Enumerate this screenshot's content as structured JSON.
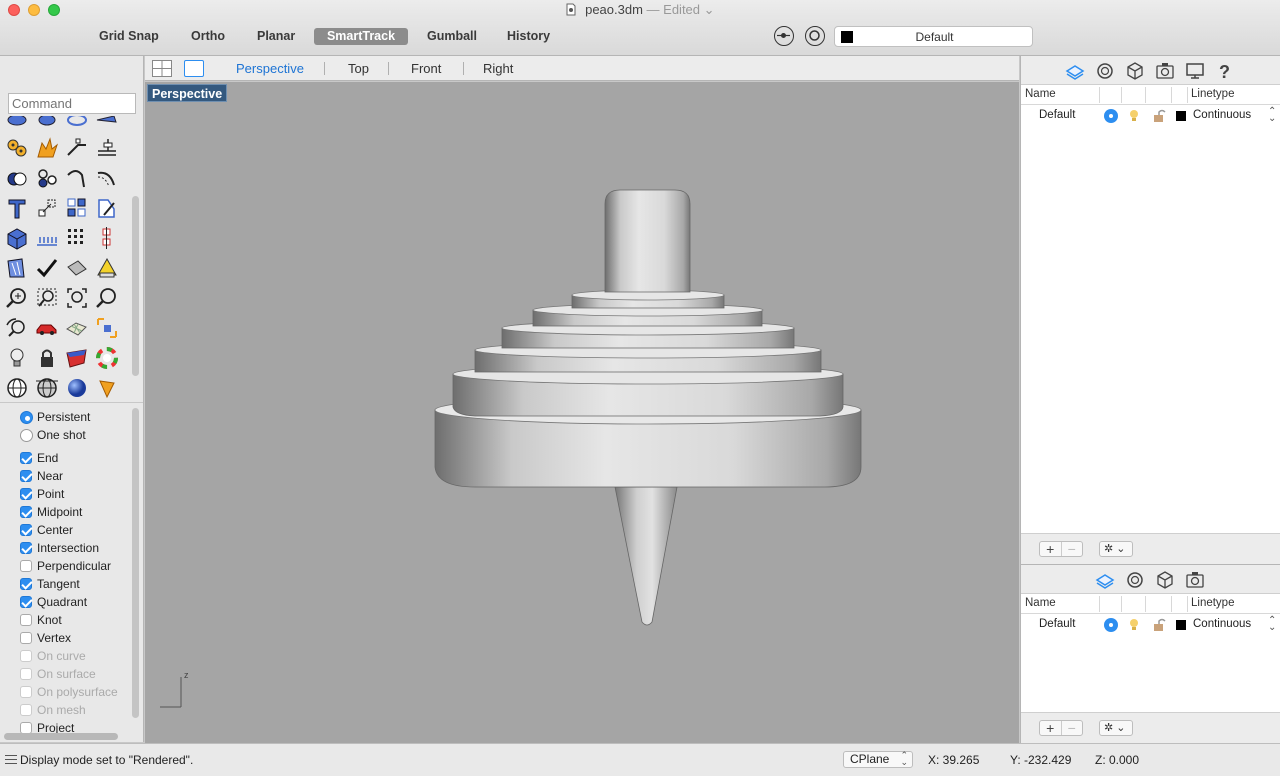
{
  "window": {
    "title": "peao.3dm",
    "edited": "— Edited ⌄"
  },
  "toolbar": {
    "items": [
      {
        "label": "Grid Snap",
        "active": false
      },
      {
        "label": "Ortho",
        "active": false
      },
      {
        "label": "Planar",
        "active": false
      },
      {
        "label": "SmartTrack",
        "active": true
      },
      {
        "label": "Gumball",
        "active": false
      },
      {
        "label": "History",
        "active": false
      }
    ],
    "layer_select": "Default"
  },
  "command": {
    "placeholder": "Command"
  },
  "tool_icons": [
    "row1-partial",
    "gears-icon",
    "explode-icon",
    "edit-points-icon",
    "dimension-icon",
    "boolean-icon",
    "group-icon",
    "curve-edit-icon",
    "fillet-curve-icon",
    "text-icon",
    "scale-icon",
    "array-icon",
    "transform-icon",
    "solid-box-icon",
    "grid-array-icon",
    "points-grid-icon",
    "alignment-icon",
    "analyze-icon",
    "check-icon",
    "shade-icon",
    "paint-icon",
    "zoom-icon",
    "zoom-window-icon",
    "zoom-extents-icon",
    "zoom-selected-icon",
    "rotate-view-icon",
    "car-icon",
    "render-mesh-icon",
    "snapshot-icon",
    "light-icon",
    "lock-icon",
    "material-icon",
    "color-wheel-icon",
    "globe-icon",
    "globe-grid-icon",
    "sphere-icon",
    "cone-icon"
  ],
  "snaps": {
    "modes": [
      {
        "label": "Persistent",
        "on": true
      },
      {
        "label": "One shot",
        "on": false
      }
    ],
    "items": [
      {
        "label": "End",
        "on": true,
        "enabled": true
      },
      {
        "label": "Near",
        "on": true,
        "enabled": true
      },
      {
        "label": "Point",
        "on": true,
        "enabled": true
      },
      {
        "label": "Midpoint",
        "on": true,
        "enabled": true
      },
      {
        "label": "Center",
        "on": true,
        "enabled": true
      },
      {
        "label": "Intersection",
        "on": true,
        "enabled": true
      },
      {
        "label": "Perpendicular",
        "on": false,
        "enabled": true
      },
      {
        "label": "Tangent",
        "on": true,
        "enabled": true
      },
      {
        "label": "Quadrant",
        "on": true,
        "enabled": true
      },
      {
        "label": "Knot",
        "on": false,
        "enabled": true
      },
      {
        "label": "Vertex",
        "on": false,
        "enabled": true
      },
      {
        "label": "On curve",
        "on": false,
        "enabled": false
      },
      {
        "label": "On surface",
        "on": false,
        "enabled": false
      },
      {
        "label": "On polysurface",
        "on": false,
        "enabled": false
      },
      {
        "label": "On mesh",
        "on": false,
        "enabled": false
      },
      {
        "label": "Project",
        "on": false,
        "enabled": true
      }
    ]
  },
  "viewport": {
    "tabs": [
      "Perspective",
      "Top",
      "Front",
      "Right"
    ],
    "active_tab": "Perspective",
    "label": "Perspective",
    "axis_z": "z"
  },
  "layers_panel": {
    "headers": {
      "name": "Name",
      "linetype": "Linetype"
    },
    "rows": [
      {
        "name": "Default",
        "linetype": "Continuous"
      }
    ]
  },
  "layers_panel_2": {
    "headers": {
      "name": "Name",
      "linetype": "Linetype"
    },
    "rows": [
      {
        "name": "Default",
        "linetype": "Continuous"
      }
    ]
  },
  "status": {
    "message": "Display mode set to \"Rendered\".",
    "cplane": "CPlane",
    "x": "X: 39.265",
    "y": "Y: -232.429",
    "z": "Z: 0.000"
  },
  "colors": {
    "accent": "#2d8ef0",
    "viewport_bg": "#a5a5a5",
    "viewport_label_bg": "#34597f"
  }
}
